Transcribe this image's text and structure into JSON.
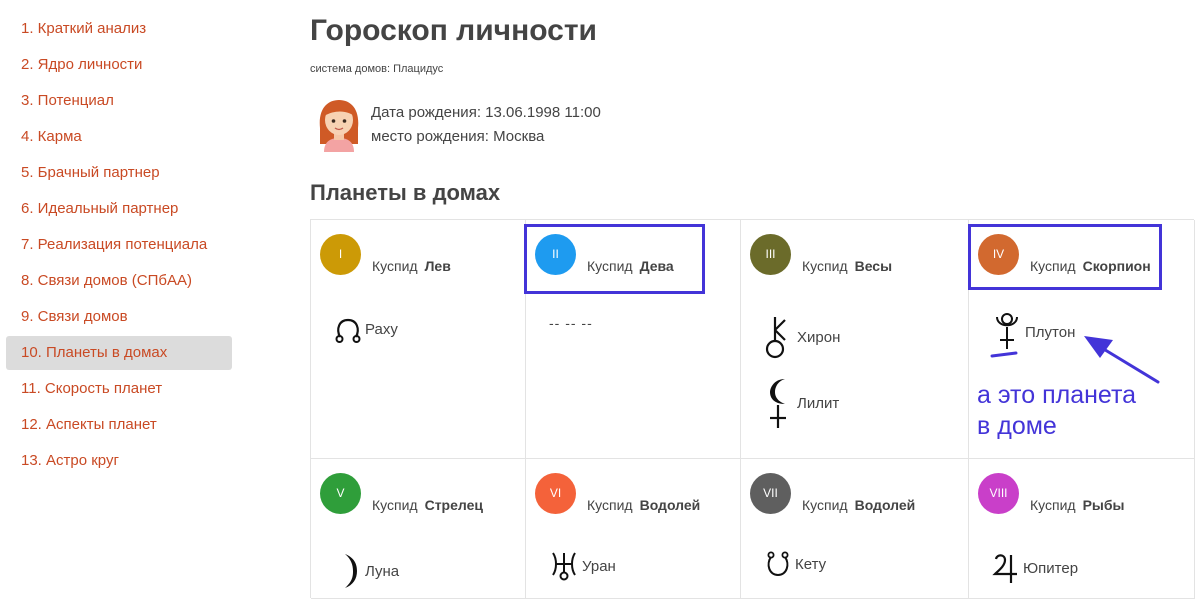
{
  "sidebar": {
    "items": [
      {
        "label": "1. Краткий анализ"
      },
      {
        "label": "2. Ядро личности"
      },
      {
        "label": "3. Потенциал"
      },
      {
        "label": "4. Карма"
      },
      {
        "label": "5. Брачный партнер"
      },
      {
        "label": "6. Идеальный партнер"
      },
      {
        "label": "7. Реализация потенциала"
      },
      {
        "label": "8. Связи домов (СПбАА)"
      },
      {
        "label": "9. Связи домов"
      },
      {
        "label": "10. Планеты в домах"
      },
      {
        "label": "11. Скорость планет"
      },
      {
        "label": "12. Аспекты планет"
      },
      {
        "label": "13. Астро круг"
      }
    ],
    "active_index": 9
  },
  "header": {
    "title": "Гороскоп личности",
    "subtitle": "система домов: Плацидус",
    "birth_date": "Дата рождения: 13.06.1998 11:00",
    "birth_place": "место рождения: Москва"
  },
  "section": {
    "title": "Планеты в домах"
  },
  "houses": [
    {
      "numeral": "I",
      "color": "#cc9a06",
      "cusp_label": "Куспид",
      "sign": "Лев",
      "planets": [
        {
          "name": "Раху",
          "icon": "rahu-icon"
        }
      ]
    },
    {
      "numeral": "II",
      "color": "#1e9bf0",
      "cusp_label": "Куспид",
      "sign": "Дева",
      "empty": "-- -- --",
      "planets": []
    },
    {
      "numeral": "III",
      "color": "#6b6b2a",
      "cusp_label": "Куспид",
      "sign": "Весы",
      "planets": [
        {
          "name": "Хирон",
          "icon": "chiron-icon"
        },
        {
          "name": "Лилит",
          "icon": "lilith-icon"
        }
      ]
    },
    {
      "numeral": "IV",
      "color": "#d2692f",
      "cusp_label": "Куспид",
      "sign": "Скорпион",
      "planets": [
        {
          "name": "Плутон",
          "icon": "pluto-icon"
        }
      ]
    },
    {
      "numeral": "V",
      "color": "#2f9e3a",
      "cusp_label": "Куспид",
      "sign": "Стрелец",
      "planets": [
        {
          "name": "Луна",
          "icon": "moon-icon"
        }
      ]
    },
    {
      "numeral": "VI",
      "color": "#f4623a",
      "cusp_label": "Куспид",
      "sign": "Водолей",
      "planets": [
        {
          "name": "Уран",
          "icon": "uranus-icon"
        }
      ]
    },
    {
      "numeral": "VII",
      "color": "#5f5f5f",
      "cusp_label": "Куспид",
      "sign": "Водолей",
      "planets": [
        {
          "name": "Кету",
          "icon": "ketu-icon"
        }
      ]
    },
    {
      "numeral": "VIII",
      "color": "#c93fc9",
      "cusp_label": "Куспид",
      "sign": "Рыбы",
      "planets": [
        {
          "name": "Юпитер",
          "icon": "jupiter-icon"
        }
      ]
    }
  ],
  "annotation": {
    "line1": "а это планета",
    "line2": "в доме",
    "color": "#4334d8"
  }
}
